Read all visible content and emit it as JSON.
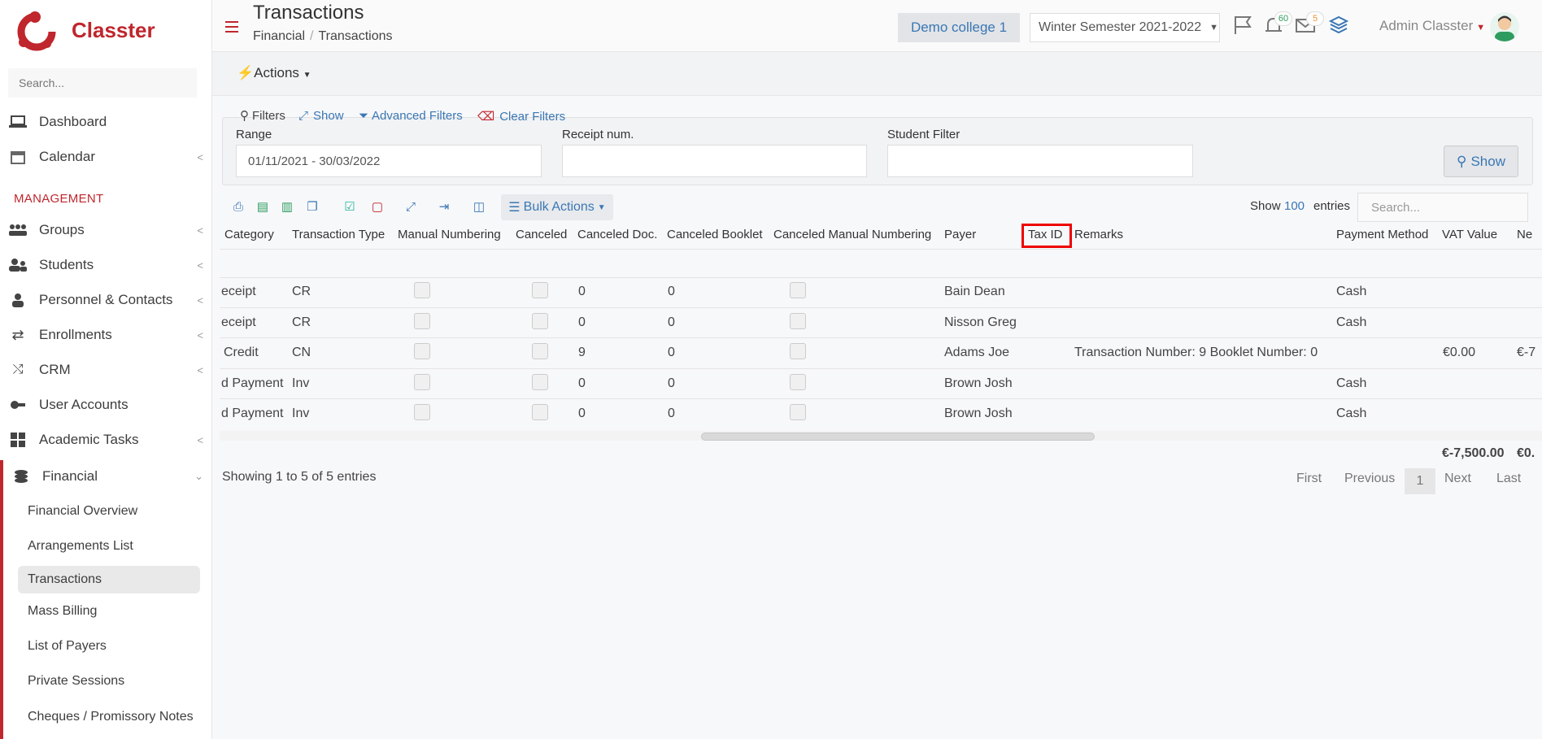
{
  "app": {
    "name": "Classter"
  },
  "sidebar": {
    "search_placeholder": "Search...",
    "section_management": "MANAGEMENT",
    "items": [
      {
        "label": "Dashboard"
      },
      {
        "label": "Calendar"
      },
      {
        "label": "Groups"
      },
      {
        "label": "Students"
      },
      {
        "label": "Personnel & Contacts"
      },
      {
        "label": "Enrollments"
      },
      {
        "label": "CRM"
      },
      {
        "label": "User Accounts"
      },
      {
        "label": "Academic Tasks"
      },
      {
        "label": "Financial"
      }
    ],
    "financial_sub": [
      {
        "label": "Financial Overview"
      },
      {
        "label": "Arrangements List"
      },
      {
        "label": "Transactions"
      },
      {
        "label": "Mass Billing"
      },
      {
        "label": "List of Payers"
      },
      {
        "label": "Private Sessions"
      },
      {
        "label": "Cheques / Promissory Notes"
      }
    ]
  },
  "header": {
    "title": "Transactions",
    "breadcrumb": [
      "Financial",
      "Transactions"
    ],
    "college": "Demo college 1",
    "semester": "Winter Semester 2021-2022",
    "notifications_count": "60",
    "messages_count": "5",
    "user_name": "Admin Classter"
  },
  "toolbar": {
    "actions_label": "Actions"
  },
  "filters": {
    "title": "Filters",
    "show_link": "Show",
    "advanced_link": "Advanced Filters",
    "clear_link": "Clear Filters",
    "range_label": "Range",
    "range_value": "01/11/2021 - 30/03/2022",
    "receipt_label": "Receipt num.",
    "receipt_value": "",
    "student_label": "Student Filter",
    "student_value": "",
    "show_button": "Show"
  },
  "table": {
    "bulk_actions": "Bulk Actions",
    "show_label": "Show",
    "entries_count": "100",
    "entries_label": "entries",
    "search_placeholder": "Search...",
    "columns": [
      "Category",
      "Transaction Type",
      "Manual Numbering",
      "Canceled",
      "Canceled Doc.",
      "Canceled Booklet",
      "Canceled Manual Numbering",
      "Payer",
      "Tax ID",
      "Remarks",
      "Payment Method",
      "VAT Value",
      "Ne"
    ],
    "rows": [
      {
        "category": "eceipt",
        "type": "CR",
        "canceled_doc": "0",
        "canceled_booklet": "0",
        "payer": "Bain Dean",
        "remarks": "",
        "payment_method": "Cash",
        "vat": "",
        "net": ""
      },
      {
        "category": "eceipt",
        "type": "CR",
        "canceled_doc": "0",
        "canceled_booklet": "0",
        "payer": "Nisson Greg",
        "remarks": "",
        "payment_method": "Cash",
        "vat": "",
        "net": ""
      },
      {
        "category": "Credit",
        "type": "CN",
        "canceled_doc": "9",
        "canceled_booklet": "0",
        "payer": "Adams Joe",
        "remarks": "Transaction Number: 9 Booklet Number: 0",
        "payment_method": "",
        "vat": "€0.00",
        "net": "€-7"
      },
      {
        "category": "d Payment",
        "type": "Inv",
        "canceled_doc": "0",
        "canceled_booklet": "0",
        "payer": "Brown Josh",
        "remarks": "",
        "payment_method": "Cash",
        "vat": "",
        "net": ""
      },
      {
        "category": "d Payment",
        "type": "Inv",
        "canceled_doc": "0",
        "canceled_booklet": "0",
        "payer": "Brown Josh",
        "remarks": "",
        "payment_method": "Cash",
        "vat": "",
        "net": ""
      }
    ],
    "total_vat": "€-7,500.00",
    "total_net": "€0.",
    "showing_text": "Showing 1 to 5 of 5 entries",
    "pagination": {
      "first": "First",
      "previous": "Previous",
      "current": "1",
      "next": "Next",
      "last": "Last"
    }
  },
  "colors": {
    "brand": "#c0262d",
    "link": "#3a77b4",
    "highlight_box": "#e00000"
  }
}
